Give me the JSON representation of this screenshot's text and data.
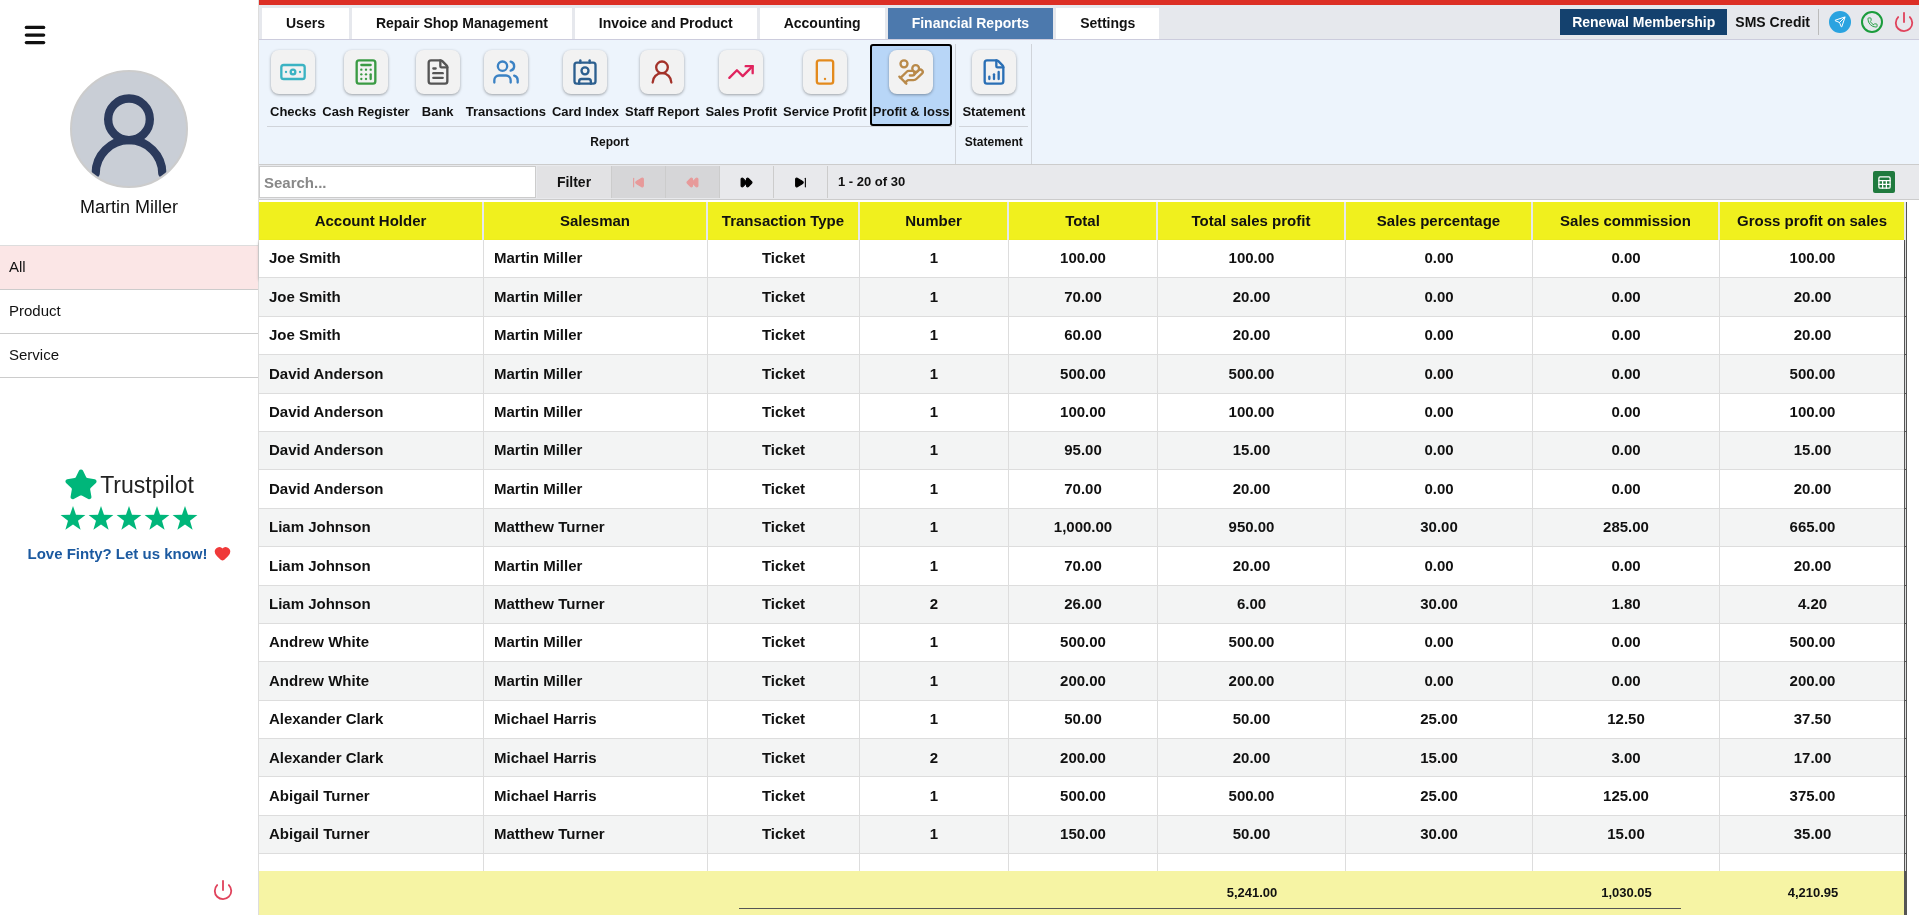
{
  "sidebar": {
    "user_name": "Martin Miller",
    "items": [
      {
        "label": "All",
        "selected": true
      },
      {
        "label": "Product",
        "selected": false
      },
      {
        "label": "Service",
        "selected": false
      }
    ],
    "trustpilot": {
      "brand": "Trustpilot",
      "stars": 5,
      "tagline": "Love Finty? Let us know!"
    }
  },
  "tabs": [
    {
      "label": "Users",
      "selected": false
    },
    {
      "label": "Repair Shop Management",
      "selected": false
    },
    {
      "label": "Invoice and Product",
      "selected": false
    },
    {
      "label": "Accounting",
      "selected": false
    },
    {
      "label": "Financial Reports",
      "selected": true
    },
    {
      "label": "Settings",
      "selected": false
    }
  ],
  "header_actions": {
    "renewal": "Renewal Membership",
    "sms": "SMS Credit"
  },
  "ribbon_groups": [
    {
      "title": "Report",
      "items": [
        {
          "label": "Checks",
          "selected": false
        },
        {
          "label": "Cash Register",
          "selected": false
        },
        {
          "label": "Bank",
          "selected": false
        },
        {
          "label": "Transactions",
          "selected": false
        },
        {
          "label": "Card Index",
          "selected": false
        },
        {
          "label": "Staff Report",
          "selected": false
        },
        {
          "label": "Sales Profit",
          "selected": false
        },
        {
          "label": "Service Profit",
          "selected": false
        },
        {
          "label": "Profit & loss",
          "selected": true
        }
      ]
    },
    {
      "title": "Statement",
      "items": [
        {
          "label": "Statement",
          "selected": false
        }
      ]
    }
  ],
  "toolbar": {
    "search_placeholder": "Search...",
    "filter": "Filter",
    "pager": [
      {
        "kind": "first",
        "disabled": true
      },
      {
        "kind": "prev",
        "disabled": true
      },
      {
        "kind": "next",
        "disabled": false
      },
      {
        "kind": "last",
        "disabled": false
      }
    ],
    "range": "1 - 20 of 30"
  },
  "table": {
    "columns": [
      "Account Holder",
      "Salesman",
      "Transaction Type",
      "Number",
      "Total",
      "Total sales profit",
      "Sales percentage",
      "Sales commission",
      "Gross profit on sales"
    ],
    "rows": [
      [
        "Joe Smith",
        "Martin Miller",
        "Ticket",
        "1",
        "100.00",
        "100.00",
        "0.00",
        "0.00",
        "100.00"
      ],
      [
        "Joe Smith",
        "Martin Miller",
        "Ticket",
        "1",
        "70.00",
        "20.00",
        "0.00",
        "0.00",
        "20.00"
      ],
      [
        "Joe Smith",
        "Martin Miller",
        "Ticket",
        "1",
        "60.00",
        "20.00",
        "0.00",
        "0.00",
        "20.00"
      ],
      [
        "David Anderson",
        "Martin Miller",
        "Ticket",
        "1",
        "500.00",
        "500.00",
        "0.00",
        "0.00",
        "500.00"
      ],
      [
        "David Anderson",
        "Martin Miller",
        "Ticket",
        "1",
        "100.00",
        "100.00",
        "0.00",
        "0.00",
        "100.00"
      ],
      [
        "David Anderson",
        "Martin Miller",
        "Ticket",
        "1",
        "95.00",
        "15.00",
        "0.00",
        "0.00",
        "15.00"
      ],
      [
        "David Anderson",
        "Martin Miller",
        "Ticket",
        "1",
        "70.00",
        "20.00",
        "0.00",
        "0.00",
        "20.00"
      ],
      [
        "Liam Johnson",
        "Matthew Turner",
        "Ticket",
        "1",
        "1,000.00",
        "950.00",
        "30.00",
        "285.00",
        "665.00"
      ],
      [
        "Liam Johnson",
        "Martin Miller",
        "Ticket",
        "1",
        "70.00",
        "20.00",
        "0.00",
        "0.00",
        "20.00"
      ],
      [
        "Liam Johnson",
        "Matthew Turner",
        "Ticket",
        "2",
        "26.00",
        "6.00",
        "30.00",
        "1.80",
        "4.20"
      ],
      [
        "Andrew White",
        "Martin Miller",
        "Ticket",
        "1",
        "500.00",
        "500.00",
        "0.00",
        "0.00",
        "500.00"
      ],
      [
        "Andrew White",
        "Martin Miller",
        "Ticket",
        "1",
        "200.00",
        "200.00",
        "0.00",
        "0.00",
        "200.00"
      ],
      [
        "Alexander Clark",
        "Michael Harris",
        "Ticket",
        "1",
        "50.00",
        "50.00",
        "25.00",
        "12.50",
        "37.50"
      ],
      [
        "Alexander Clark",
        "Michael Harris",
        "Ticket",
        "2",
        "200.00",
        "20.00",
        "15.00",
        "3.00",
        "17.00"
      ],
      [
        "Abigail Turner",
        "Michael Harris",
        "Ticket",
        "1",
        "500.00",
        "500.00",
        "25.00",
        "125.00",
        "375.00"
      ],
      [
        "Abigail Turner",
        "Matthew Turner",
        "Ticket",
        "1",
        "150.00",
        "50.00",
        "30.00",
        "15.00",
        "35.00"
      ]
    ],
    "totals": {
      "total_sales_profit": "5,241.00",
      "sales_commission": "1,030.05",
      "gross_profit_on_sales": "4,210.95"
    }
  }
}
